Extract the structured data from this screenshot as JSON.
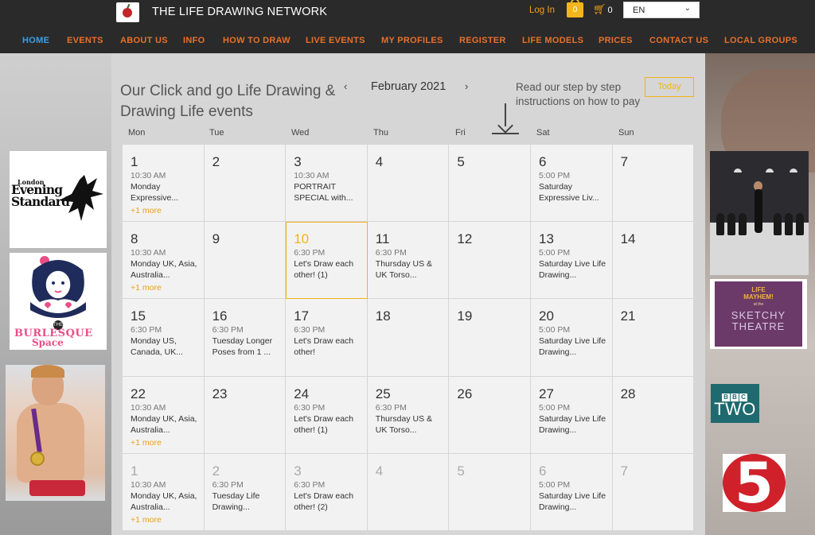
{
  "header": {
    "site_title": "THE LIFE DRAWING NETWORK",
    "login": "Log In",
    "bag_count": "0",
    "cart_count": "0",
    "language": "EN"
  },
  "nav": {
    "items": [
      "HOME",
      "EVENTS",
      "ABOUT US",
      "INFO",
      "HOW TO DRAW",
      "LIVE EVENTS",
      "MY PROFILES",
      "REGISTER",
      "LIFE MODELS",
      "PRICES",
      "CONTACT US",
      "LOCAL GROUPS"
    ],
    "active": "HOME"
  },
  "calendar": {
    "title": "Our Click and go Life Drawing & Drawing Life events",
    "month": "February 2021",
    "prev_icon": "‹",
    "next_icon": "›",
    "pay_note": "Read our step by step instructions on how to pay",
    "today": "Today",
    "weekdays": [
      "Mon",
      "Tue",
      "Wed",
      "Thu",
      "Fri",
      "Sat",
      "Sun"
    ],
    "weeks": [
      [
        {
          "day": "1",
          "time": "10:30 AM",
          "title": "Monday Expressive...",
          "more": "+1 more"
        },
        {
          "day": "2"
        },
        {
          "day": "3",
          "time": "10:30 AM",
          "title": "PORTRAIT SPECIAL with..."
        },
        {
          "day": "4"
        },
        {
          "day": "5"
        },
        {
          "day": "6",
          "time": "5:00 PM",
          "title": "Saturday Expressive Liv..."
        },
        {
          "day": "7"
        }
      ],
      [
        {
          "day": "8",
          "time": "10:30 AM",
          "title": "Monday UK, Asia, Australia...",
          "more": "+1 more"
        },
        {
          "day": "9"
        },
        {
          "day": "10",
          "time": "6:30 PM",
          "title": "Let's Draw each other! (1)",
          "selected": true
        },
        {
          "day": "11",
          "time": "6:30 PM",
          "title": "Thursday US & UK Torso..."
        },
        {
          "day": "12"
        },
        {
          "day": "13",
          "time": "5:00 PM",
          "title": "Saturday Live Life Drawing..."
        },
        {
          "day": "14"
        }
      ],
      [
        {
          "day": "15",
          "time": "6:30 PM",
          "title": "Monday US, Canada, UK..."
        },
        {
          "day": "16",
          "time": "6:30 PM",
          "title": "Tuesday Longer Poses from 1 ..."
        },
        {
          "day": "17",
          "time": "6:30 PM",
          "title": "Let's Draw each other!"
        },
        {
          "day": "18"
        },
        {
          "day": "19"
        },
        {
          "day": "20",
          "time": "5:00 PM",
          "title": "Saturday Live Life Drawing..."
        },
        {
          "day": "21"
        }
      ],
      [
        {
          "day": "22",
          "time": "10:30 AM",
          "title": "Monday UK, Asia, Australia...",
          "more": "+1 more"
        },
        {
          "day": "23"
        },
        {
          "day": "24",
          "time": "6:30 PM",
          "title": "Let's Draw each other! (1)"
        },
        {
          "day": "25",
          "time": "6:30 PM",
          "title": "Thursday US & UK Torso..."
        },
        {
          "day": "26"
        },
        {
          "day": "27",
          "time": "5:00 PM",
          "title": "Saturday Live Life Drawing..."
        },
        {
          "day": "28"
        }
      ],
      [
        {
          "day": "1",
          "time": "10:30 AM",
          "title": "Monday UK, Asia, Australia...",
          "more": "+1 more",
          "other": true
        },
        {
          "day": "2",
          "time": "6:30 PM",
          "title": "Tuesday Life Drawing...",
          "other": true
        },
        {
          "day": "3",
          "time": "6:30 PM",
          "title": "Let's Draw each other! (2)",
          "other": true
        },
        {
          "day": "4",
          "other": true
        },
        {
          "day": "5",
          "other": true
        },
        {
          "day": "6",
          "time": "5:00 PM",
          "title": "Saturday Live Life Drawing...",
          "other": true
        },
        {
          "day": "7",
          "other": true
        }
      ]
    ]
  },
  "logos": {
    "evening_standard_small": "London",
    "evening_standard": "Evening Standard",
    "burlesque_the": "THE",
    "burlesque_line1": "BURLESQUE",
    "burlesque_line2": "Space",
    "sketchy_top": "LIFE MAYHEM!",
    "sketchy_at": "at the",
    "sketchy_main": "SKETCHY THEATRE",
    "bbc_letters": [
      "B",
      "B",
      "C"
    ],
    "bbc_channel": "TWO",
    "channel5": "5"
  },
  "colors": {
    "accent_orange": "#e8702a",
    "accent_gold": "#f0b41b",
    "nav_active": "#3ba0e8",
    "topbar_bg": "#2a2a2a",
    "panel_bg": "#d6d6d6",
    "cell_bg": "#f2f2f2"
  }
}
